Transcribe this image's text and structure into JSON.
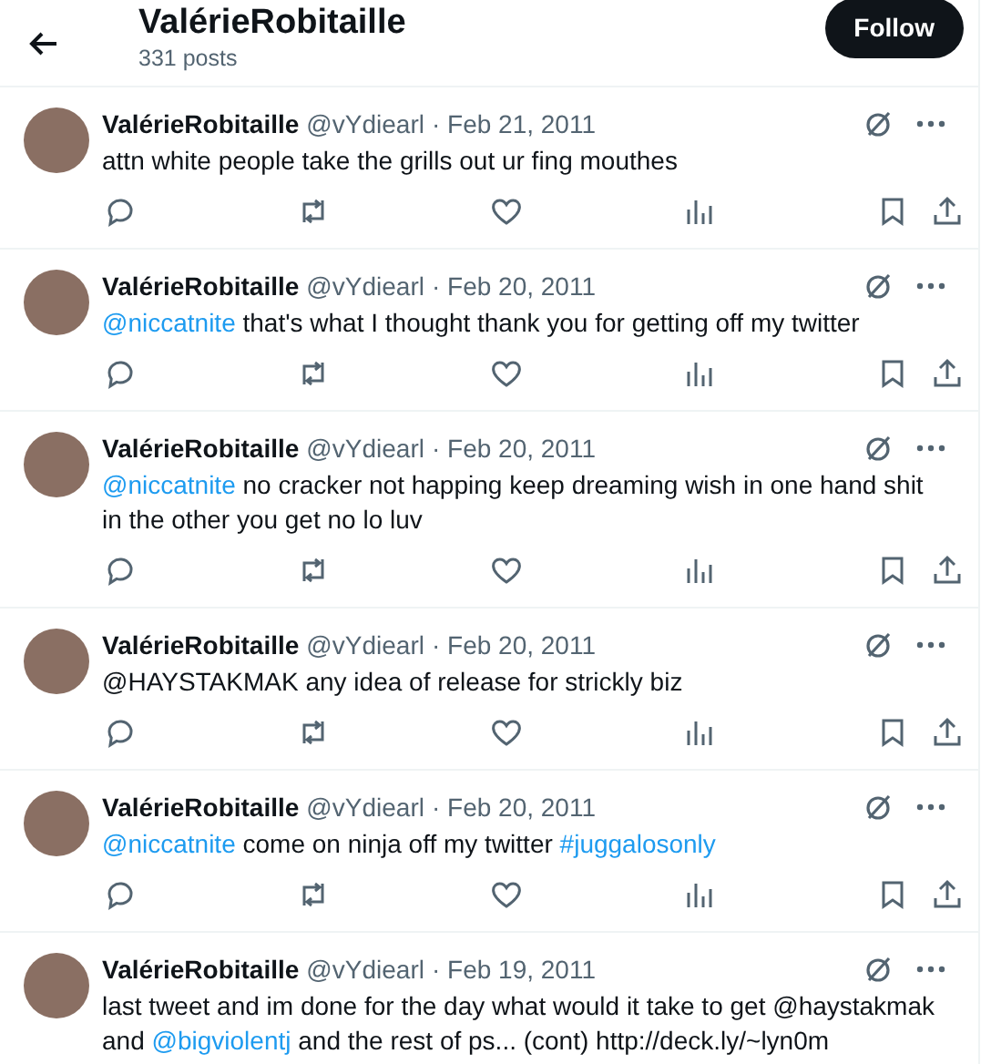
{
  "header": {
    "name": "ValérieRobitaille",
    "post_count": "331 posts",
    "follow_button": "Follow"
  },
  "tweets": [
    {
      "name": "ValérieRobitaille",
      "handle": "@vYdiearl",
      "date": "· Feb 21, 2011",
      "segments": [
        {
          "kind": "text",
          "text": "attn white people take the grills out ur fing mouthes"
        }
      ]
    },
    {
      "name": "ValérieRobitaille",
      "handle": "@vYdiearl",
      "date": "· Feb 20, 2011",
      "segments": [
        {
          "kind": "mention",
          "text": "@niccatnite"
        },
        {
          "kind": "text",
          "text": " that's what I thought thank you for getting off my twitter"
        }
      ]
    },
    {
      "name": "ValérieRobitaille",
      "handle": "@vYdiearl",
      "date": "· Feb 20, 2011",
      "segments": [
        {
          "kind": "mention",
          "text": "@niccatnite"
        },
        {
          "kind": "text",
          "text": " no cracker not happing keep dreaming wish in one hand shit in the other you get no lo luv"
        }
      ]
    },
    {
      "name": "ValérieRobitaille",
      "handle": "@vYdiearl",
      "date": "· Feb 20, 2011",
      "segments": [
        {
          "kind": "text",
          "text": "@HAYSTAKMAK any idea of release for strickly biz"
        }
      ]
    },
    {
      "name": "ValérieRobitaille",
      "handle": "@vYdiearl",
      "date": "· Feb 20, 2011",
      "segments": [
        {
          "kind": "mention",
          "text": "@niccatnite"
        },
        {
          "kind": "text",
          "text": " come on ninja off my twitter "
        },
        {
          "kind": "hashtag",
          "text": "#juggalosonly"
        }
      ]
    },
    {
      "name": "ValérieRobitaille",
      "handle": "@vYdiearl",
      "date": "· Feb 19, 2011",
      "segments": [
        {
          "kind": "text",
          "text": "last tweet and im done for the day what would it take to get @haystakmak and "
        },
        {
          "kind": "mention",
          "text": "@bigviolentj"
        },
        {
          "kind": "text",
          "text": " and the rest of ps... (cont) http://deck.ly/~lyn0m"
        }
      ]
    }
  ]
}
